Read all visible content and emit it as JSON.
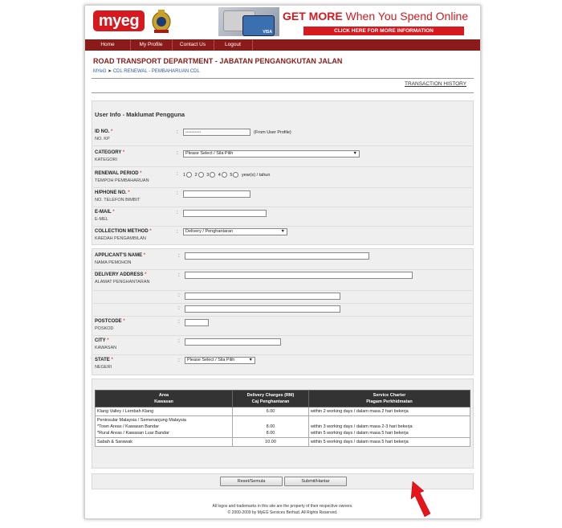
{
  "header": {
    "logo_text": "myeg",
    "banner_title_a": "GET MORE",
    "banner_title_b": " When You Spend Online",
    "banner_button": "CLICK HERE FOR MORE INFORMATION",
    "card_text": "VISA"
  },
  "nav": [
    "Home",
    "My Profile",
    "Contact Us",
    "Logout"
  ],
  "page": {
    "department_title": "ROAD TRANSPORT DEPARTMENT - JABATAN PENGANGKUTAN JALAN",
    "breadcrumb_root": "MYeG",
    "breadcrumb_sep": "➤",
    "breadcrumb_current": "CDL RENEWAL - PEMBAHARUAN CDL",
    "transaction_history": "TRANSACTION HISTORY",
    "section_title": "User Info - Maklumat Pengguna"
  },
  "form": {
    "id_no": {
      "label": "ID NO.",
      "sub": "NO. KP",
      "note": "(From User Profile)",
      "value": "••••••••••"
    },
    "category": {
      "label": "CATEGORY",
      "sub": "KATEGORI",
      "selected": "Please Select / Sila Pilih"
    },
    "renewal": {
      "label": "RENEWAL PERIOD",
      "sub": "TEMPOH PEMBAHARUAN",
      "options": [
        "1",
        "2",
        "3",
        "4",
        "5"
      ],
      "suffix": "year(s) / tahun"
    },
    "phone": {
      "label": "H/PHONE NO.",
      "sub": "NO. TELEFON BIMBIT"
    },
    "email": {
      "label": "E-MAIL",
      "sub": "E-MEL"
    },
    "collection": {
      "label": "COLLECTION METHOD",
      "sub": "KAEDAH PENGAMBILAN",
      "selected": "Delivery / Penghantaran"
    },
    "applicant": {
      "label": "APPLICANT'S NAME",
      "sub": "NAMA PEMOHON"
    },
    "address": {
      "label": "DELIVERY ADDRESS",
      "sub": "ALAMAT PENGHANTARAN"
    },
    "postcode": {
      "label": "POSTCODE",
      "sub": "POSKOD"
    },
    "city": {
      "label": "CITY",
      "sub": "KAWASAN"
    },
    "state": {
      "label": "STATE",
      "sub": "NEGERI",
      "selected": "Please Select / Sila Pilih"
    },
    "required_mark": "*",
    "colon": ":"
  },
  "charges": {
    "headers": [
      {
        "title": "Area",
        "sub": "Kawasan"
      },
      {
        "title": "Delivery Charges (RM)",
        "sub": "Caj Penghantaran"
      },
      {
        "title": "Service Charter",
        "sub": "Piagam Perkhidmatan"
      }
    ],
    "rows": [
      {
        "area": [
          "Klang Valley / Lembah Klang"
        ],
        "charge": [
          "6.00"
        ],
        "charter": [
          "within 2 working days / dalam masa 2 hari bekerja"
        ]
      },
      {
        "area": [
          "Peninsular Malaysia / Semenanjung Malaysia",
          "*Town Areas / Kawasan Bandar",
          "*Rural Areas / Kawasan Luar Bandar"
        ],
        "charge": [
          "",
          "8.00",
          "8.00"
        ],
        "charter": [
          "",
          "within 3 working days / dalam masa 2-3 hari bekerja",
          "within 5 working days / dalam masa 5 hari bekerja"
        ]
      },
      {
        "area": [
          "Sabah & Sarawak"
        ],
        "charge": [
          "10.00"
        ],
        "charter": [
          "within 5 working days / dalam masa 5 hari bekerja"
        ]
      }
    ]
  },
  "buttons": {
    "reset": "Reset/Semula",
    "submit": "Submit/Hantar"
  },
  "footer": {
    "line1": "All logos and trademarks in this site are the property of their respective owners.",
    "line2": "© 2000-2009 by MyEG Services Berhad. All Rights Reserved."
  },
  "colors": {
    "brand_red": "#d6181f",
    "nav_maroon": "#8b1a1a",
    "arrow_red": "#e8141c"
  }
}
